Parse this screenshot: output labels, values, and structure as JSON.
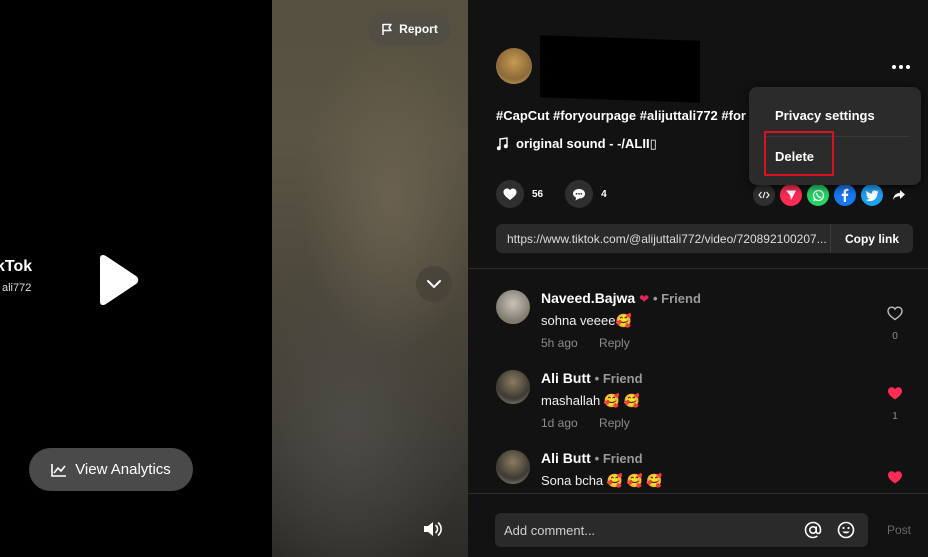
{
  "video": {
    "watermark_title": "kTok",
    "watermark_user": "ali772",
    "report_label": "Report",
    "analytics_label": "View Analytics"
  },
  "post": {
    "caption": "#CapCut #foryourpage #alijuttali772 #for",
    "sound": "original sound - -/ALII▯",
    "likes": "56",
    "comments": "4",
    "link": "https://www.tiktok.com/@alijuttali772/video/720892100207...",
    "copy_label": "Copy link"
  },
  "menu": {
    "privacy": "Privacy settings",
    "delete": "Delete",
    "highlight_color": "#d8121f"
  },
  "comments": [
    {
      "name": "Naveed.Bajwa",
      "tag": "• Friend",
      "text": "sohna veeee🥰",
      "time": "5h ago",
      "reply": "Reply",
      "likes": "0",
      "liked": false
    },
    {
      "name": "Ali Butt",
      "tag": "• Friend",
      "text": "mashallah 🥰 🥰",
      "time": "1d ago",
      "reply": "Reply",
      "likes": "1",
      "liked": true
    },
    {
      "name": "Ali Butt",
      "tag": "• Friend",
      "text": "Sona bcha 🥰 🥰 🥰",
      "time": "",
      "reply": "",
      "likes": "",
      "liked": true
    }
  ],
  "composer": {
    "placeholder": "Add comment...",
    "post_label": "Post"
  },
  "colors": {
    "like_red": "#fe2c55",
    "panel_bg": "#121212",
    "share_embed": "#2f2f2f",
    "share_send": "#fe2c55",
    "share_whatsapp": "#25d366",
    "share_facebook": "#1877f2",
    "share_twitter": "#1da1f2"
  }
}
